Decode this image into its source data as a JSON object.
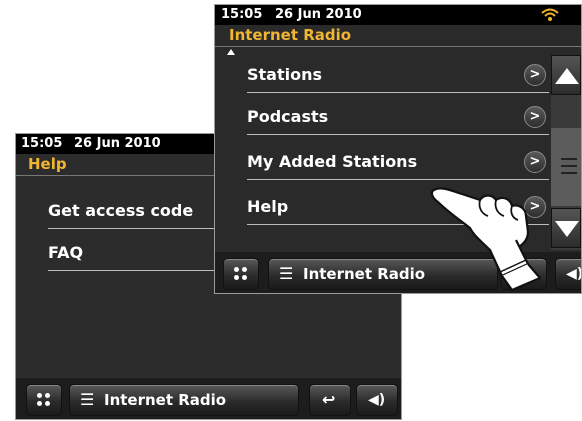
{
  "back_screen": {
    "status": {
      "time": "15:05",
      "date": "26 Jun 2010"
    },
    "title": "Help",
    "items": [
      {
        "label": "Get access code"
      },
      {
        "label": "FAQ"
      }
    ],
    "bottom": {
      "source_label": "Internet Radio"
    }
  },
  "front_screen": {
    "status": {
      "time": "15:05",
      "date": "26 Jun 2010",
      "wifi_icon": "wifi-icon"
    },
    "title": "Internet Radio",
    "items": [
      {
        "label": "Stations"
      },
      {
        "label": "Podcasts"
      },
      {
        "label": "My Added Stations"
      },
      {
        "label": "Help"
      }
    ],
    "bottom": {
      "source_label": "Internet Radio"
    }
  },
  "icons": {
    "menu_dots": "menu-dots-icon",
    "list": "list-icon",
    "back": "back-icon",
    "volume": "volume-icon",
    "chevron": "chevron-right-icon",
    "hand": "pointing-hand-icon"
  },
  "colors": {
    "title_accent": "#f2b531",
    "wifi": "#f2b531"
  }
}
